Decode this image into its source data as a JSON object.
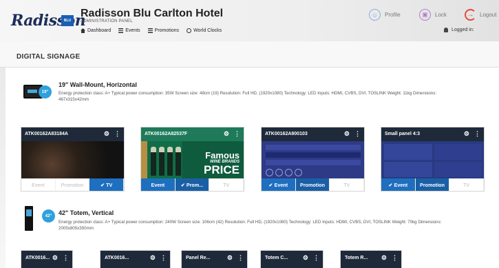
{
  "header": {
    "logo": "Radisson",
    "logo_badge": "BLU",
    "hotel_title": "Radisson Blu Carlton Hotel",
    "admin_panel": "ADMINISTRATION PANEL",
    "nav": [
      {
        "label": "Dashboard",
        "icon": "home-icon"
      },
      {
        "label": "Events",
        "icon": "list-icon"
      },
      {
        "label": "Promotions",
        "icon": "list-icon"
      },
      {
        "label": "World Clocks",
        "icon": "clock-icon"
      }
    ],
    "profile": "Profile",
    "lock": "Lock",
    "logout": "Logout",
    "logged_in": "Logged in:"
  },
  "page": {
    "title": "DIGITAL SIGNAGE"
  },
  "products": [
    {
      "badge": "19\"",
      "title": "19\" Wall-Mount, Horizontal",
      "desc_line1": "Energy protection class: A+ Typical power consumption: 35W Screen size: 48cm (19) Resolution: Full HD, (1920x1080) Technology: LED Inputs: HDMI, CVBS, DVI, TOSLINK Weight: 11kg Dimensions:",
      "desc_line2": "467x315x42mm"
    },
    {
      "badge": "42\"",
      "title": "42\" Totem, Vertical",
      "desc_line1": "Energy protection class: A+ Typical power consumption: 240W Screen size: 106cm (42) Resolution: Full HD, (1920x1080) Technology: LED Inputs: HDMI, CVBS, DVI, TOSLINK Weight: 70kg Dimensions:",
      "desc_line2": "2005x805x350mm"
    }
  ],
  "cards": [
    {
      "title": "ATK00162A83184A",
      "tabs": [
        "Event",
        "Promotion",
        "✔ TV"
      ],
      "active": [
        2
      ]
    },
    {
      "title": "ATK00162A82537F",
      "tabs": [
        "Event",
        "✔ Prom...",
        "TV"
      ],
      "active": [
        0,
        1
      ],
      "thumb_text": [
        "Famous",
        "WINE BRANDS",
        "PRICE"
      ]
    },
    {
      "title": "ATK00162A800103",
      "tabs": [
        "✔ Event",
        "Promotion",
        "TV"
      ],
      "active": [
        0,
        1
      ]
    },
    {
      "title": "Small panel 4:3",
      "tabs": [
        "✔ Event",
        "Promotion",
        "TV"
      ],
      "active": [
        0,
        1
      ]
    }
  ],
  "mini_cards": [
    "ATK0016...",
    "ATK0016...",
    "Panel Re...",
    "Totem C...",
    "Totem R..."
  ],
  "colors": {
    "accent": "#1e6fbf",
    "card_header": "#1e2a3a",
    "badge": "#2ea1db",
    "logout": "#e5483c"
  }
}
